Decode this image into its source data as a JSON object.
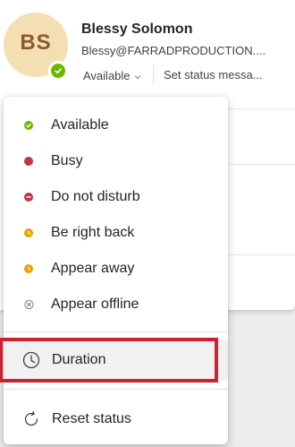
{
  "profile": {
    "initials": "BS",
    "name": "Blessy Solomon",
    "email": "Blessy@FARRADPRODUCTION....",
    "current_status": "Available",
    "set_status_message": "Set status messa...",
    "presence_color": "#6bb700"
  },
  "status_menu": {
    "items": [
      {
        "label": "Available",
        "icon": "available-icon",
        "color": "#6bb700"
      },
      {
        "label": "Busy",
        "icon": "busy-icon",
        "color": "#c4314b"
      },
      {
        "label": "Do not disturb",
        "icon": "do-not-disturb-icon",
        "color": "#c4314b"
      },
      {
        "label": "Be right back",
        "icon": "be-right-back-icon",
        "color": "#eaa300"
      },
      {
        "label": "Appear away",
        "icon": "appear-away-icon",
        "color": "#eaa300"
      },
      {
        "label": "Appear offline",
        "icon": "appear-offline-icon",
        "color": "#8a8886"
      }
    ],
    "duration_label": "Duration",
    "reset_label": "Reset status",
    "highlight_color": "#d01f2f"
  }
}
